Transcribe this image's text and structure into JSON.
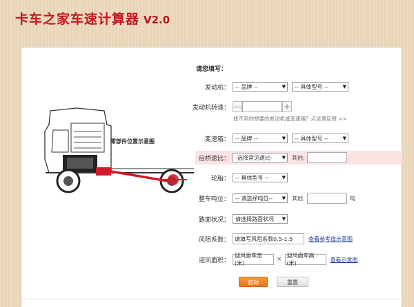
{
  "header": {
    "title": "卡车之家车速计算器",
    "version": "V2.0"
  },
  "diagram": {
    "label": "零部件位置示意图"
  },
  "form": {
    "heading": "请您填写：",
    "engine": {
      "label": "发动机：",
      "brand": "-- 品牌 --",
      "model": "-- 具体型号 --"
    },
    "rpm": {
      "label": "发动机转速：",
      "minus": "—",
      "plus": "+",
      "value": "",
      "hint": "找不到你想要的发动机或变速箱？点这里反馈 >>"
    },
    "gearbox": {
      "label": "变速箱：",
      "brand": "-- 品牌 --",
      "model": "-- 具体型号 --"
    },
    "axle": {
      "label": "后桥速比：",
      "select": "-选择常见速比-",
      "other_label": "其他:",
      "other_value": ""
    },
    "tire": {
      "label": "轮胎：",
      "select": "-- 具体型号 --"
    },
    "weight": {
      "label": "整车吨位：",
      "select": "-- 请选择吨位--",
      "other_label": "其他:",
      "other_value": "",
      "unit": "吨"
    },
    "road": {
      "label": "路面状况：",
      "select": "请选择路面状况"
    },
    "drag": {
      "label": "风阻系数：",
      "placeholder": "请填写风阻系数0.5-1.5",
      "link": "查看参考值示意图"
    },
    "area": {
      "label": "迎风面积：",
      "width": "迎风面车宽(米)",
      "times": "×",
      "height": "迎风面车高(米)",
      "link": "查看示意图"
    },
    "start_label": "启动",
    "reset_label": "重置"
  },
  "colors": {
    "title_red": "#c9141b",
    "start_orange": "#f08a2a",
    "highlight": "#fbe3e3",
    "link_blue": "#1b3f9a"
  }
}
